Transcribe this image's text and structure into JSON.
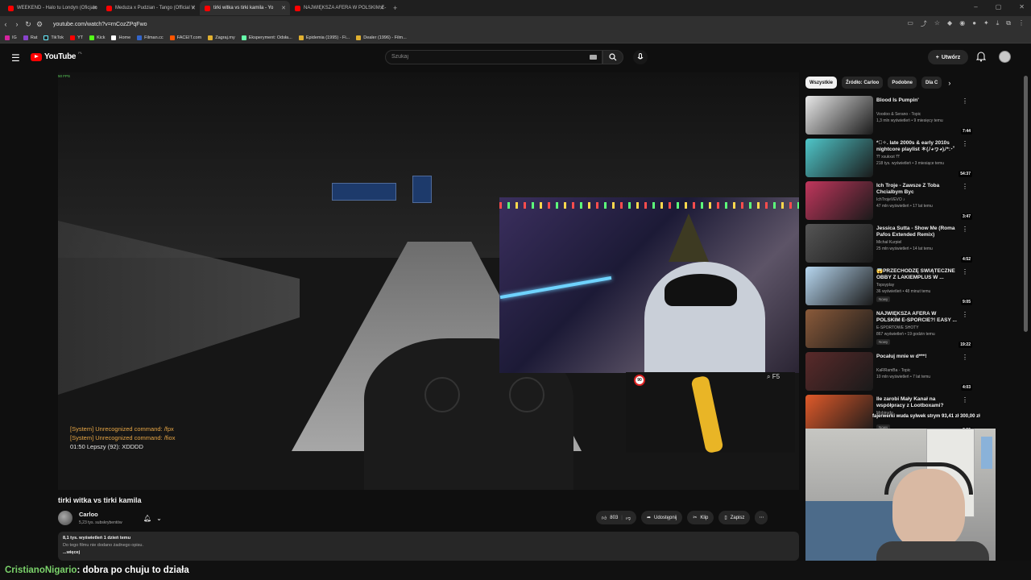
{
  "browser": {
    "tabs": [
      {
        "label": "WEEKEND - Halo tu Londyn (Oficjaln",
        "active": false
      },
      {
        "label": "Meduza x Pudzian - Tango (Official V",
        "active": false
      },
      {
        "label": "tirki witka vs tirki kamila - Yo",
        "active": true
      },
      {
        "label": "NAJWIĘKSZA AFERA W POLSKIM E-",
        "active": false
      }
    ],
    "url": "youtube.com/watch?v=rnCozZPqFwo",
    "bookmarks": [
      "IG",
      "Rat",
      "TikTok",
      "YT",
      "Kick",
      "Home",
      "Filman.cc",
      "FACEIT.com",
      "Zagraj.my",
      "Eksperyment: Odsła...",
      "Epidemia (1995) - Fi...",
      "Dealer (1996) - Film..."
    ]
  },
  "header": {
    "logo_text": "YouTube",
    "country_code": "PL",
    "search_placeholder": "Szukaj",
    "create_label": "Utwórz"
  },
  "player": {
    "fps_label": "50 FPS",
    "chat_lines": [
      {
        "text": "[System] Unrecognized command: /fpx",
        "type": "sys"
      },
      {
        "text": "[System] Unrecognized command: /fiox",
        "type": "sys"
      },
      {
        "text": "01:50 Lepszy (92): XDDDD",
        "type": "usr"
      }
    ],
    "speed_limit": "90",
    "gps_key": "F5"
  },
  "video": {
    "title": "tirki witka vs tirki kamila",
    "channel": "Carloo",
    "subscribers": "5,23 tys. subskrybentów",
    "likes": "803",
    "share_label": "Udostępnij",
    "clip_label": "Klip",
    "save_label": "Zapisz",
    "meta": "8,1 tys. wyświetleń  1 dzień temu",
    "description": "Do tego filmu nie dodano żadnego opisu.",
    "more_label": "...więcej"
  },
  "sidebar": {
    "chips": [
      "Wszystkie",
      "Źródło: Carloo",
      "Podobne",
      "Dla C"
    ],
    "recommendations": [
      {
        "title": "Blood Is Pumpin'",
        "channel": "Voodoo & Serano - Topic",
        "stats": "1,3 mln wyświetleń • 9 miesięcy temu",
        "duration": "7:44",
        "badge": "",
        "thumb": "#e8e8e8"
      },
      {
        "title": "*ﾟ✧. late 2000s & early 2010s nightcore playlist ＊(ﾉ◕ヮ◕)ﾉ*:･ﾟ✧",
        "channel": "ꔫ xsukxst ꔫ",
        "stats": "218 tys. wyświetleń • 3 miesiące temu",
        "duration": "54:37",
        "badge": "",
        "thumb": "#4fc6c9"
      },
      {
        "title": "Ich Troje - Zawsze Z Toba Chcialbym Byc",
        "channel": "IchTrojeVEVO ♪",
        "stats": "47 mln wyświetleń • 17 lat temu",
        "duration": "3:47",
        "badge": "",
        "thumb": "#c0365c"
      },
      {
        "title": "Jessica Sutta - Show Me (Roma Pafos Extended Remix)",
        "channel": "Michał Kurpiel",
        "stats": "25 mln wyświetleń • 14 lat temu",
        "duration": "4:52",
        "badge": "",
        "thumb": "#555555"
      },
      {
        "title": "😱PRZECHODZĘ ŚWIĄTECZNE OBBY Z LAKIEMPLUS W ...",
        "channel": "Topsyplay",
        "stats": "36 wyświetleń • 48 minut temu",
        "duration": "9:05",
        "badge": "Nowy",
        "thumb": "#b7d7f0"
      },
      {
        "title": "NAJWIĘKSZA AFERA W POLSKIM E-SPORCIE?! EASY ...",
        "channel": "E-SPORTOWE SHOTY",
        "stats": "867 wyświetleń • 19 godzin temu",
        "duration": "19:22",
        "badge": "Nowy",
        "thumb": "#8a5a3a"
      },
      {
        "title": "Pocałuj mnie w d***!",
        "channel": "KaRRamBa - Topic",
        "stats": "10 mln wyświetleń • 7 lat temu",
        "duration": "4:03",
        "badge": "",
        "thumb": "#5a2a2a"
      },
      {
        "title": "Ile zarobi Mały Kanał na współpracy z Lootboxami?",
        "channel": "Mobirudo",
        "stats": "",
        "duration": "7:59",
        "badge": "Nowy",
        "thumb": "#e05a2a"
      }
    ],
    "donation": "fajerwerki wuda sylwek strym  93,41 zł  300,00 zł"
  },
  "overlay_chat": {
    "user": "CristianoNigario",
    "message": " : dobra po chuju to działa"
  },
  "colors": {
    "accent": "#ff0000",
    "chat_user": "#7bd36b",
    "system_chat": "#e7a645"
  }
}
